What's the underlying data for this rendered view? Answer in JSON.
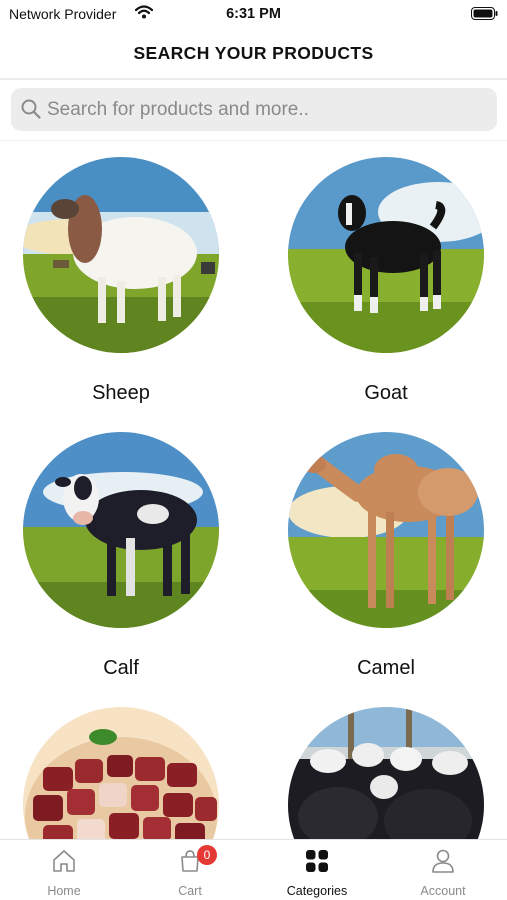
{
  "status_bar": {
    "carrier": "Network Provider",
    "time": "6:31 PM",
    "icons": [
      "wifi-icon",
      "battery-icon"
    ]
  },
  "header": {
    "title": "SEARCH YOUR PRODUCTS"
  },
  "search": {
    "placeholder": "Search for products and more..",
    "value": "",
    "icon": "search-icon"
  },
  "categories": [
    {
      "label": "Sheep",
      "image": "sheep-photo"
    },
    {
      "label": "Goat",
      "image": "goat-photo"
    },
    {
      "label": "Calf",
      "image": "calf-photo"
    },
    {
      "label": "Camel",
      "image": "camel-photo"
    },
    {
      "image": "meat-photo"
    },
    {
      "image": "goat-herd-photo"
    }
  ],
  "tab_bar": {
    "tabs": [
      {
        "label": "Home",
        "icon": "home-icon",
        "active": false
      },
      {
        "label": "Cart",
        "icon": "cart-icon",
        "active": false,
        "badge": "0"
      },
      {
        "label": "Categories",
        "icon": "categories-icon",
        "active": true
      },
      {
        "label": "Account",
        "icon": "account-icon",
        "active": false
      }
    ]
  },
  "colors": {
    "search_bg": "#ececec",
    "badge": "#e53935",
    "active_tab": "#111111",
    "inactive_tab": "#8a8a8a"
  }
}
